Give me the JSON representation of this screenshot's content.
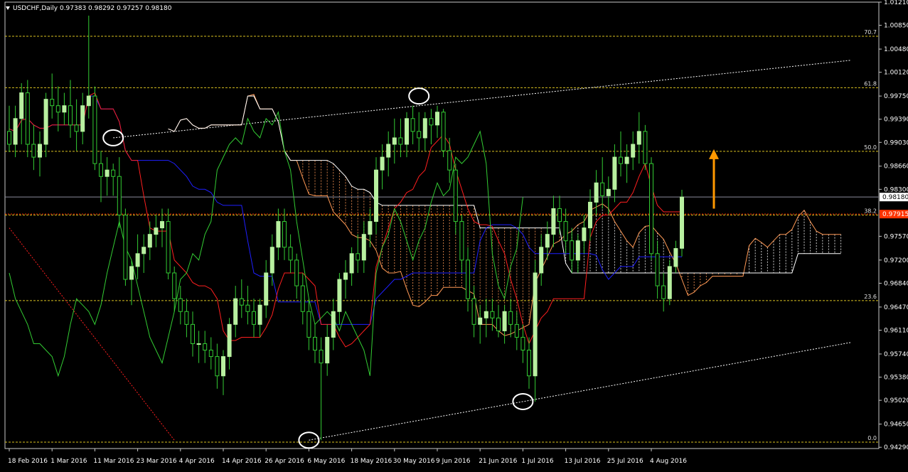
{
  "header": {
    "symbol": "USDCHF,Daily",
    "ohlc": "0.97383 0.98292 0.97257 0.98180"
  },
  "colors": {
    "background": "#000000",
    "bull_candle": "#b8f0a0",
    "wick": "#33cc33",
    "tenkan": "#ff1f1f",
    "kijun": "#1f1fff",
    "chikou": "#33cc33",
    "fib_level": "#d8c020",
    "trendline": "#ffffff",
    "cloud_bull": "#ffffff",
    "cloud_bear": "#ff9955",
    "arrow": "#ff9900",
    "price_line": "#8a8a9a",
    "ask_line": "#ff3300"
  },
  "chart_data": {
    "type": "candlestick",
    "instrument": "USDCHF",
    "timeframe": "Daily",
    "last": {
      "open": 0.97383,
      "high": 0.98292,
      "low": 0.97257,
      "close": 0.9818
    },
    "ylim": [
      0.9427,
      1.0121
    ],
    "y_ticks": [
      "1.01210",
      "1.00850",
      "1.00480",
      "1.00120",
      "0.99750",
      "0.99390",
      "0.99030",
      "0.98660",
      "0.98300",
      "0.97570",
      "0.97200",
      "0.96840",
      "0.96470",
      "0.96110",
      "0.95740",
      "0.95380",
      "0.95020",
      "0.94650",
      "0.94290"
    ],
    "x_ticks": [
      "18 Feb 2016",
      "1 Mar 2016",
      "11 Mar 2016",
      "23 Mar 2016",
      "4 Apr 2016",
      "14 Apr 2016",
      "26 Apr 2016",
      "6 May 2016",
      "18 May 2016",
      "30 May 2016",
      "9 Jun 2016",
      "21 Jun 2016",
      "1 Jul 2016",
      "13 Jul 2016",
      "25 Jul 2016",
      "4 Aug 2016"
    ],
    "price_labels": {
      "current": "0.98180",
      "ask": "0.97915"
    },
    "fib_levels": [
      {
        "label": "70.7",
        "price": 1.0068
      },
      {
        "label": "61.8",
        "price": 0.9988
      },
      {
        "label": "50.0",
        "price": 0.9889
      },
      {
        "label": "38.2",
        "price": 0.979
      },
      {
        "label": "23.6",
        "price": 0.9657
      },
      {
        "label": "0.0",
        "price": 0.9437
      }
    ],
    "ohlc": [
      [
        0.992,
        0.996,
        0.9888,
        0.99
      ],
      [
        0.99,
        0.996,
        0.988,
        0.994
      ],
      [
        0.994,
        0.9995,
        0.99,
        0.998
      ],
      [
        0.998,
        1.0,
        0.988,
        0.99
      ],
      [
        0.99,
        0.993,
        0.986,
        0.988
      ],
      [
        0.988,
        0.992,
        0.985,
        0.99
      ],
      [
        0.99,
        0.998,
        0.988,
        0.997
      ],
      [
        0.997,
        1.001,
        0.994,
        0.996
      ],
      [
        0.996,
        0.999,
        0.992,
        0.995
      ],
      [
        0.995,
        0.998,
        0.993,
        0.996
      ],
      [
        0.996,
        1.0,
        0.991,
        0.993
      ],
      [
        0.993,
        0.997,
        0.989,
        0.992
      ],
      [
        0.992,
        0.998,
        0.99,
        0.996
      ],
      [
        0.996,
        1.01,
        0.994,
        0.9975
      ],
      [
        0.9975,
        0.999,
        0.986,
        0.987
      ],
      [
        0.987,
        0.989,
        0.981,
        0.985
      ],
      [
        0.985,
        0.988,
        0.982,
        0.986
      ],
      [
        0.986,
        0.987,
        0.982,
        0.985
      ],
      [
        0.985,
        0.988,
        0.977,
        0.979
      ],
      [
        0.979,
        0.98,
        0.968,
        0.969
      ],
      [
        0.969,
        0.972,
        0.965,
        0.971
      ],
      [
        0.971,
        0.976,
        0.969,
        0.973
      ],
      [
        0.973,
        0.976,
        0.97,
        0.974
      ],
      [
        0.974,
        0.978,
        0.972,
        0.976
      ],
      [
        0.976,
        0.979,
        0.974,
        0.977
      ],
      [
        0.977,
        0.98,
        0.974,
        0.978
      ],
      [
        0.978,
        0.98,
        0.969,
        0.97
      ],
      [
        0.97,
        0.971,
        0.964,
        0.966
      ],
      [
        0.966,
        0.968,
        0.962,
        0.964
      ],
      [
        0.964,
        0.966,
        0.96,
        0.962
      ],
      [
        0.962,
        0.964,
        0.957,
        0.959
      ],
      [
        0.959,
        0.961,
        0.956,
        0.959
      ],
      [
        0.959,
        0.961,
        0.956,
        0.958
      ],
      [
        0.958,
        0.96,
        0.955,
        0.957
      ],
      [
        0.957,
        0.959,
        0.952,
        0.954
      ],
      [
        0.954,
        0.958,
        0.951,
        0.957
      ],
      [
        0.957,
        0.963,
        0.955,
        0.962
      ],
      [
        0.962,
        0.968,
        0.96,
        0.966
      ],
      [
        0.966,
        0.969,
        0.963,
        0.965
      ],
      [
        0.965,
        0.968,
        0.962,
        0.964
      ],
      [
        0.964,
        0.966,
        0.96,
        0.962
      ],
      [
        0.962,
        0.966,
        0.96,
        0.965
      ],
      [
        0.965,
        0.972,
        0.963,
        0.97
      ],
      [
        0.97,
        0.976,
        0.968,
        0.974
      ],
      [
        0.974,
        0.98,
        0.972,
        0.978
      ],
      [
        0.978,
        0.98,
        0.972,
        0.974
      ],
      [
        0.974,
        0.976,
        0.97,
        0.972
      ],
      [
        0.972,
        0.973,
        0.966,
        0.968
      ],
      [
        0.968,
        0.97,
        0.962,
        0.964
      ],
      [
        0.964,
        0.966,
        0.958,
        0.96
      ],
      [
        0.96,
        0.962,
        0.956,
        0.958
      ],
      [
        0.958,
        0.96,
        0.944,
        0.956
      ],
      [
        0.956,
        0.962,
        0.954,
        0.96
      ],
      [
        0.96,
        0.966,
        0.958,
        0.964
      ],
      [
        0.964,
        0.97,
        0.962,
        0.969
      ],
      [
        0.969,
        0.972,
        0.966,
        0.97
      ],
      [
        0.97,
        0.974,
        0.968,
        0.973
      ],
      [
        0.973,
        0.976,
        0.97,
        0.972
      ],
      [
        0.972,
        0.978,
        0.97,
        0.976
      ],
      [
        0.976,
        0.98,
        0.974,
        0.978
      ],
      [
        0.978,
        0.988,
        0.976,
        0.986
      ],
      [
        0.986,
        0.99,
        0.983,
        0.988
      ],
      [
        0.988,
        0.992,
        0.985,
        0.99
      ],
      [
        0.99,
        0.994,
        0.987,
        0.991
      ],
      [
        0.991,
        0.994,
        0.988,
        0.99
      ],
      [
        0.99,
        0.995,
        0.988,
        0.994
      ],
      [
        0.994,
        0.996,
        0.99,
        0.992
      ],
      [
        0.992,
        0.995,
        0.989,
        0.991
      ],
      [
        0.991,
        0.995,
        0.989,
        0.994
      ],
      [
        0.994,
        0.9955,
        0.99,
        0.993
      ],
      [
        0.993,
        0.996,
        0.991,
        0.995
      ],
      [
        0.995,
        0.9955,
        0.988,
        0.989
      ],
      [
        0.989,
        0.991,
        0.984,
        0.986
      ],
      [
        0.986,
        0.987,
        0.976,
        0.978
      ],
      [
        0.978,
        0.979,
        0.97,
        0.972
      ],
      [
        0.972,
        0.974,
        0.964,
        0.966
      ],
      [
        0.966,
        0.968,
        0.96,
        0.962
      ],
      [
        0.962,
        0.965,
        0.959,
        0.963
      ],
      [
        0.963,
        0.966,
        0.96,
        0.964
      ],
      [
        0.964,
        0.966,
        0.961,
        0.963
      ],
      [
        0.963,
        0.965,
        0.96,
        0.961
      ],
      [
        0.961,
        0.965,
        0.959,
        0.964
      ],
      [
        0.964,
        0.966,
        0.96,
        0.962
      ],
      [
        0.962,
        0.964,
        0.958,
        0.96
      ],
      [
        0.96,
        0.962,
        0.956,
        0.958
      ],
      [
        0.958,
        0.96,
        0.952,
        0.954
      ],
      [
        0.954,
        0.972,
        0.95,
        0.97
      ],
      [
        0.97,
        0.976,
        0.968,
        0.974
      ],
      [
        0.974,
        0.978,
        0.972,
        0.976
      ],
      [
        0.976,
        0.982,
        0.974,
        0.98
      ],
      [
        0.98,
        0.982,
        0.976,
        0.978
      ],
      [
        0.978,
        0.98,
        0.973,
        0.975
      ],
      [
        0.975,
        0.977,
        0.97,
        0.972
      ],
      [
        0.972,
        0.976,
        0.97,
        0.975
      ],
      [
        0.975,
        0.979,
        0.973,
        0.977
      ],
      [
        0.977,
        0.983,
        0.975,
        0.981
      ],
      [
        0.981,
        0.986,
        0.979,
        0.984
      ],
      [
        0.984,
        0.988,
        0.98,
        0.982
      ],
      [
        0.982,
        0.985,
        0.979,
        0.983
      ],
      [
        0.983,
        0.99,
        0.981,
        0.988
      ],
      [
        0.988,
        0.992,
        0.985,
        0.987
      ],
      [
        0.987,
        0.99,
        0.984,
        0.988
      ],
      [
        0.988,
        0.992,
        0.986,
        0.99
      ],
      [
        0.99,
        0.995,
        0.987,
        0.992
      ],
      [
        0.992,
        0.993,
        0.986,
        0.987
      ],
      [
        0.987,
        0.988,
        0.972,
        0.973
      ],
      [
        0.973,
        0.975,
        0.966,
        0.968
      ],
      [
        0.968,
        0.97,
        0.964,
        0.966
      ],
      [
        0.966,
        0.972,
        0.965,
        0.971
      ],
      [
        0.971,
        0.975,
        0.97,
        0.9738
      ],
      [
        0.97383,
        0.98292,
        0.97257,
        0.9818
      ]
    ]
  }
}
